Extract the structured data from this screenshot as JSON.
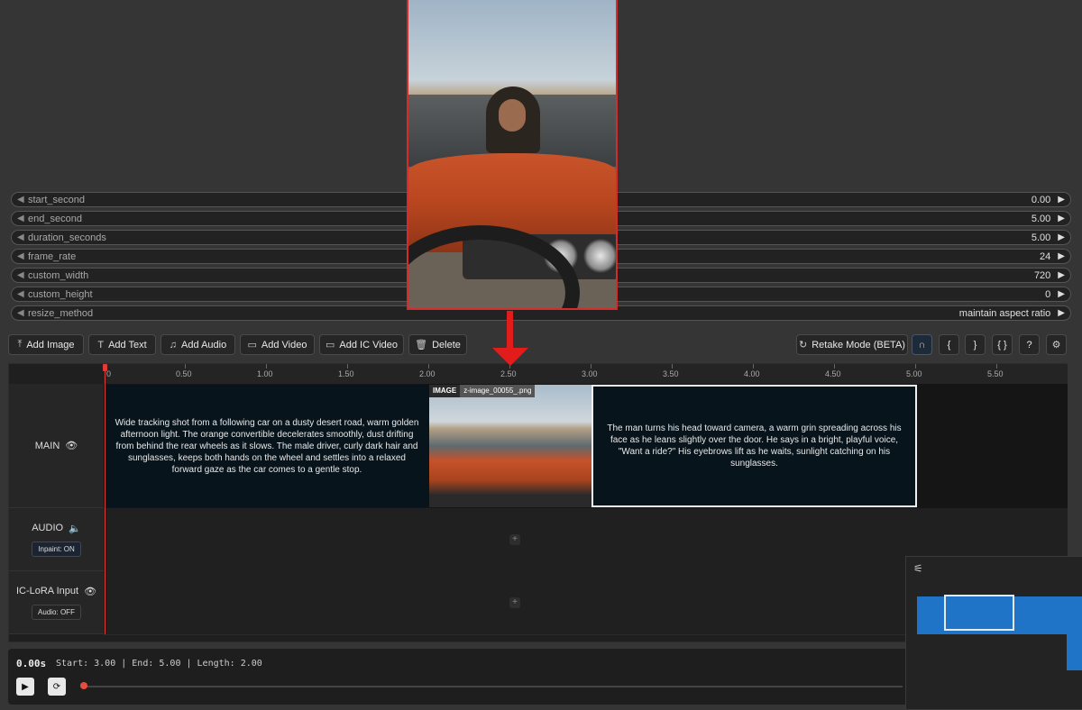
{
  "params": [
    {
      "name": "start_second",
      "value": "0.00"
    },
    {
      "name": "end_second",
      "value": "5.00"
    },
    {
      "name": "duration_seconds",
      "value": "5.00"
    },
    {
      "name": "frame_rate",
      "value": "24"
    },
    {
      "name": "custom_width",
      "value": "720"
    },
    {
      "name": "custom_height",
      "value": "0"
    },
    {
      "name": "resize_method",
      "value": "maintain aspect ratio"
    }
  ],
  "toolbar": {
    "add_image": "Add Image",
    "add_text": "Add Text",
    "add_audio": "Add Audio",
    "add_video": "Add Video",
    "add_ic_video": "Add IC Video",
    "delete": "Delete",
    "retake": "Retake Mode (BETA)",
    "brace_open": "{",
    "brace_close": "}",
    "braces": "{ }",
    "help": "?"
  },
  "ruler": [
    "0",
    "0.50",
    "1.00",
    "1.50",
    "2.00",
    "2.50",
    "3.00",
    "3.50",
    "4.00",
    "4.50",
    "5.00",
    "5.50"
  ],
  "tracks": {
    "main": {
      "label": "MAIN"
    },
    "audio": {
      "label": "AUDIO",
      "badge": "Inpaint: ON"
    },
    "iclora": {
      "label": "IC-LoRA Input",
      "badge": "Audio: OFF"
    }
  },
  "clips": {
    "text1": "Wide tracking shot from a following car on a dusty desert road, warm golden afternoon light. The orange convertible decelerates smoothly, dust drifting from behind the rear wheels as it slows. The male driver, curly dark hair and sunglasses, keeps both hands on the wheel and settles into a relaxed forward gaze as the car comes to a gentle stop.",
    "image_tag": "IMAGE",
    "image_file": "z-image_00055_.png",
    "text2": "The man turns his head toward camera, a warm grin spreading across his face as he leans slightly over the door. He says in a bright, playful voice, \"Want a ride?\" His eyebrows lift as he waits, sunlight catching on his sunglasses."
  },
  "playback": {
    "time": "0.00s",
    "range": "Start: 3.00 | End: 5.00 | Length: 2.00"
  },
  "icons": {
    "play": "play-icon",
    "loop": "loop-icon",
    "settings": "gear-icon",
    "magnet": "magnet-icon",
    "filter": "sliders-icon"
  },
  "colors": {
    "accent_red": "#e21b1b",
    "clip_bg": "#07141c",
    "minimap_blue": "#1f74c8"
  }
}
